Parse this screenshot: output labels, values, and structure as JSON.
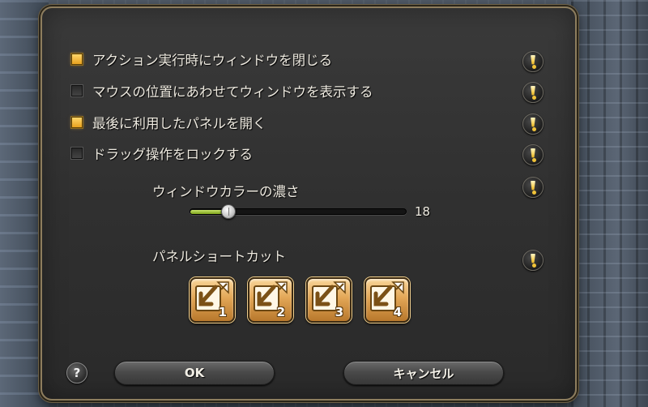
{
  "options": [
    {
      "label": "アクション実行時にウィンドウを閉じる",
      "checked": true
    },
    {
      "label": "マウスの位置にあわせてウィンドウを表示する",
      "checked": false
    },
    {
      "label": "最後に利用したパネルを開く",
      "checked": true
    },
    {
      "label": "ドラッグ操作をロックする",
      "checked": false
    }
  ],
  "window_color": {
    "label": "ウィンドウカラーの濃さ",
    "value": "18",
    "fraction": 0.18
  },
  "panel_shortcut": {
    "label": "パネルショートカット",
    "buttons": [
      {
        "number": "1"
      },
      {
        "number": "2"
      },
      {
        "number": "3"
      },
      {
        "number": "4"
      }
    ]
  },
  "footer": {
    "help_label": "?",
    "ok_label": "OK",
    "cancel_label": "キャンセル"
  },
  "icons": {
    "info": "exclamation-icon",
    "shortcut": "shortcut-arrow-icon",
    "help": "question-icon"
  },
  "colors": {
    "accent": "#f1c338",
    "checked": "#e7a11e",
    "slider_fill": "#9fc232",
    "shortcut_tile": "#e2a656"
  }
}
